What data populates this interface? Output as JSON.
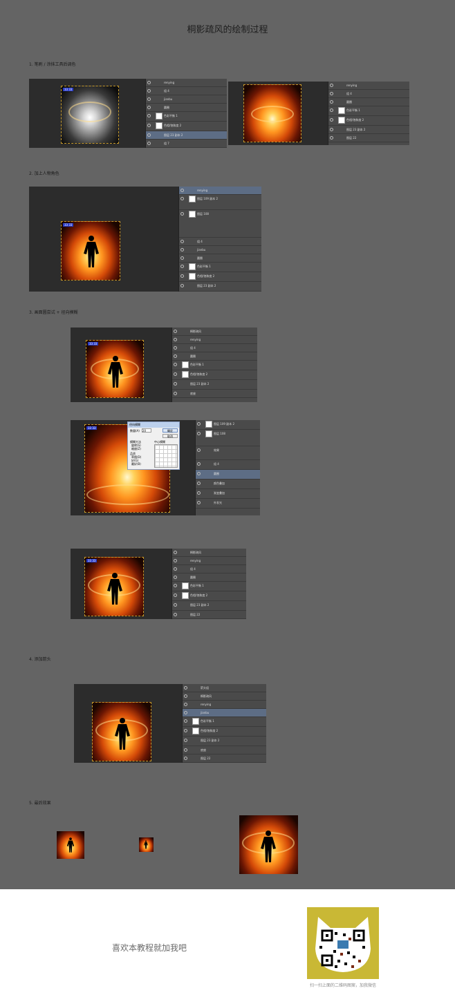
{
  "title": "桐影疏风的绘制过程",
  "steps": {
    "s1": "1. 笔刷 / 涂抹工具后调色",
    "s2": "2. 加上人物角色",
    "s3": "3. 画面圆尝试 + 径向模糊",
    "s4": "4. 添加箭头",
    "s5": "5. 最后效果"
  },
  "layers": {
    "renying": "renying",
    "zu4": "组 4",
    "jianbu": "jianbu",
    "yuanquan": "圆圈",
    "secaiping": "色彩平衡 1",
    "seceng": "色相/饱和度 2",
    "tuceng23": "图层 23 副本 2",
    "zu7": "组 7",
    "tuceng22": "图层 22",
    "dizuo": "底座",
    "tuceng109": "图层 109 副本 2",
    "tuceng108": "图层 108",
    "xiaoguo": "效果",
    "xiaoguo1": "颜色叠加",
    "xiaoguo2": "渐变叠加",
    "xiaoguo3": "外发光",
    "tongyin": "桐影疏风",
    "jiantou": "箭头组"
  },
  "canvas_badge": "33 33",
  "dialog": {
    "title": "径向模糊",
    "amount_label": "数量(A)",
    "amount_value": "20",
    "ok": "确定",
    "cancel": "取消",
    "method_label": "模糊方法",
    "method1": "旋转(S)",
    "method2": "缩放(Z)",
    "quality_label": "品质",
    "q1": "草图(D)",
    "q2": "好(G)",
    "q3": "最好(B)",
    "center_label": "中心模糊"
  },
  "footer": {
    "slogan": "喜欢本教程就加我吧",
    "qr_caption": "扫一扫上面的二维码图案，加我微信"
  },
  "colors": {
    "page_bg": "#646464",
    "panel_bg": "#4a4a4a",
    "footer_bg": "#ffffff",
    "qr_bg": "#c9b835"
  }
}
